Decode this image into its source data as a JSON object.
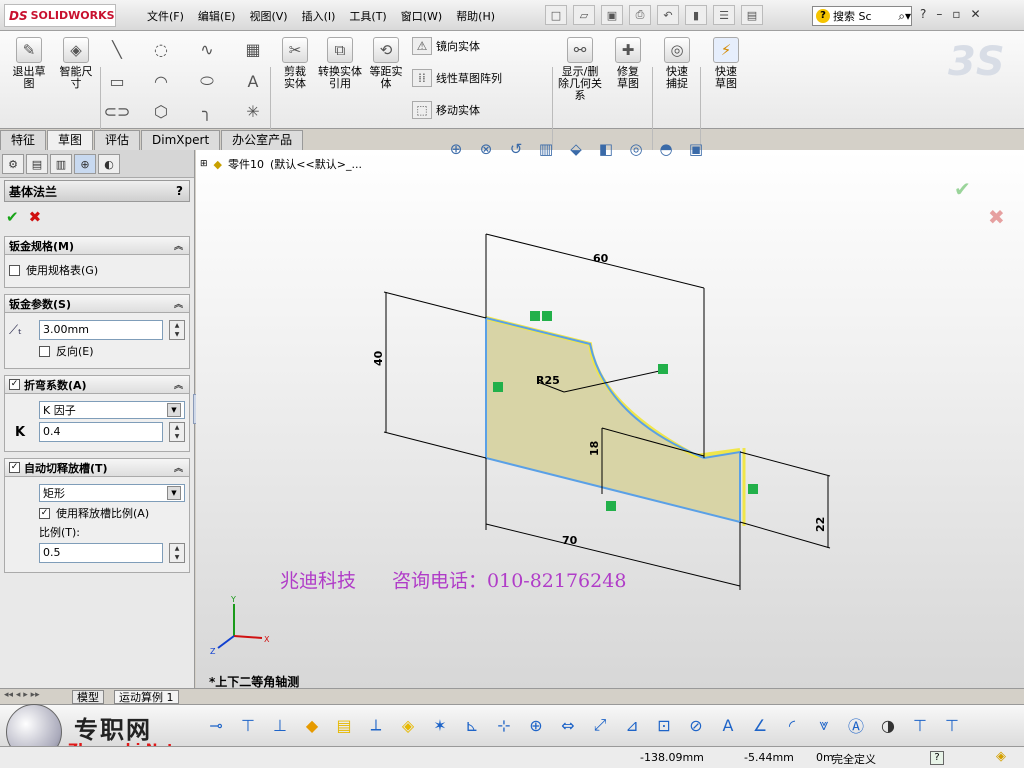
{
  "app": {
    "logo_ds": "DS",
    "logo_name": "SOLIDWORKS"
  },
  "menu": [
    "文件(F)",
    "编辑(E)",
    "视图(V)",
    "插入(I)",
    "工具(T)",
    "窗口(W)",
    "帮助(H)"
  ],
  "search": {
    "placeholder": "搜索 Sc",
    "icon_char": "?"
  },
  "window_buttons": [
    "?",
    "–",
    "▫",
    "✕"
  ],
  "ribbon": {
    "exit_sketch": "退出草图",
    "smart_dim": "智能尺寸",
    "trim": "剪裁实体",
    "convert": "转换实体引用",
    "offset": "等距实体",
    "mirror": "镜向实体",
    "linear_pattern": "线性草图阵列",
    "move": "移动实体",
    "display_relations": "显示/删除几何关系",
    "repair": "修复草图",
    "quick_snap": "快速捕捉",
    "rapid_sketch": "快速草图"
  },
  "cmd_tabs": [
    "特征",
    "草图",
    "评估",
    "DimXpert",
    "办公室产品"
  ],
  "panel": {
    "title": "基体法兰",
    "help": "?",
    "ok": "✔",
    "cancel": "✖",
    "gauge": {
      "title": "钣金规格(M)",
      "use_table": "使用规格表(G)"
    },
    "params": {
      "title": "钣金参数(S)",
      "thickness": "3.00mm",
      "reverse": "反向(E)"
    },
    "bend": {
      "title": "折弯系数(A)",
      "type": "K 因子",
      "k_label": "K",
      "k_value": "0.4"
    },
    "relief": {
      "title": "自动切释放槽(T)",
      "type": "矩形",
      "use_ratio": "使用释放槽比例(A)",
      "ratio_label": "比例(T):",
      "ratio": "0.5"
    }
  },
  "tree": {
    "part": "零件10",
    "config": "(默认<<默认>_..."
  },
  "dims": {
    "d60": "60",
    "d40": "40",
    "r25": "R25",
    "d18": "18",
    "d70": "70",
    "d22": "22"
  },
  "watermark": {
    "company": "兆迪科技",
    "phone": "咨询电话：010-82176248"
  },
  "view_label": "*上下二等角轴测",
  "bottom_tabs": {
    "model": "模型",
    "motion": "运动算例 1"
  },
  "brand": {
    "name": "专职网",
    "url": "Zhuanzhi.Net"
  },
  "status": {
    "x": "-138.09mm",
    "y": "-5.44mm",
    "z": "0m",
    "state": "完全定义"
  },
  "colors": {
    "fill": "#d8d4a6",
    "edge_blue": "#5aa0e6",
    "edge_yellow": "#f0e64a",
    "relation_green": "#22b04a",
    "dim_line": "#000000",
    "watermark": "#b03cc8"
  }
}
